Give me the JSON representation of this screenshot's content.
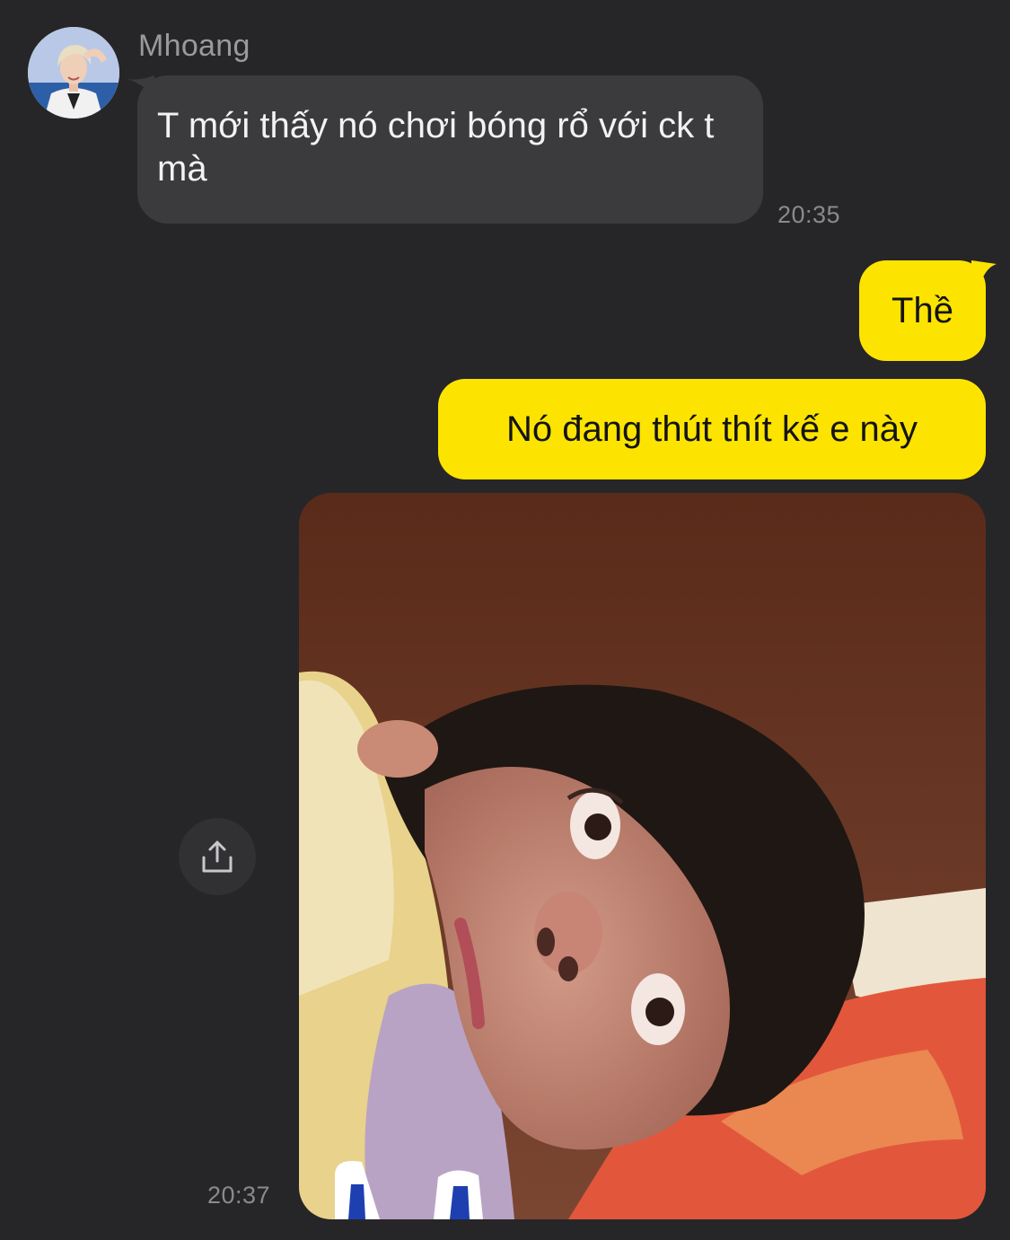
{
  "chat": {
    "colors": {
      "background": "#262628",
      "incoming_bubble": "#3b3b3e",
      "outgoing_bubble": "#fde400"
    },
    "messages": [
      {
        "direction": "incoming",
        "sender": "Mhoang",
        "text": "T mới thấy nó chơi bóng rổ với ck t mà",
        "time": "20:35"
      },
      {
        "direction": "outgoing",
        "text": "Thề"
      },
      {
        "direction": "outgoing",
        "text": "Nó đang thút thít kế e này"
      },
      {
        "direction": "outgoing",
        "type": "image",
        "time": "20:37"
      }
    ],
    "icons": {
      "share": "share-icon"
    }
  }
}
